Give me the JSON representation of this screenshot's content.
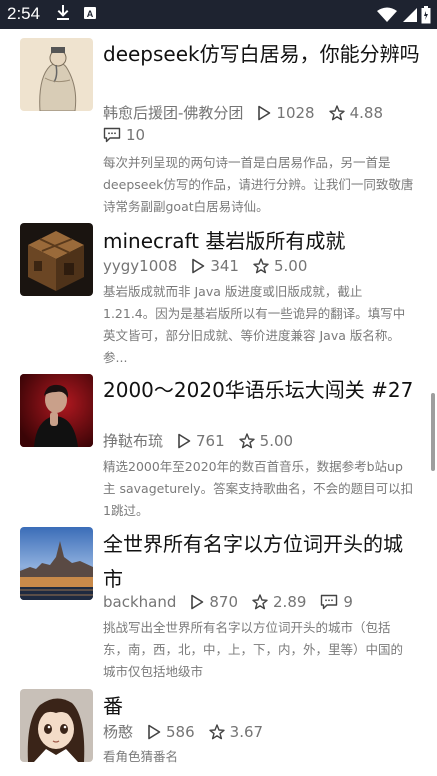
{
  "status_bar": {
    "time": "2:54",
    "icons": [
      "download-icon",
      "font-icon",
      "wifi-icon",
      "signal-icon",
      "battery-icon"
    ]
  },
  "items": [
    {
      "title": "deepseek仿写白居易，你能分辨吗",
      "author": "韩愈后援团-佛教分团",
      "plays": "1028",
      "rating": "4.88",
      "comments": "10",
      "description": "每次并列呈现的两句诗一首是白居易作品，另一首是deepseek仿写的作品，请进行分辨。让我们一同致敬唐诗常务副副goat白居易诗仙。"
    },
    {
      "title": "minecraft 基岩版所有成就",
      "author": "yygy1008",
      "plays": "341",
      "rating": "5.00",
      "description": "基岩版成就而非 Java 版进度或旧版成就，截止 1.21.4。因为是基岩版所以有一些诡异的翻译。填写中英文皆可，部分旧成就、等价进度兼容 Java 版名称。参..."
    },
    {
      "title": "2000～2020华语乐坛大闯关 #27",
      "author": "挣鞑布琉",
      "plays": "761",
      "rating": "5.00",
      "description": "精选2000年至2020年的数百首音乐，数据参考b站up主 savageturely。答案支持歌曲名，不会的题目可以扣1跳过。"
    },
    {
      "title": "全世界所有名字以方位词开头的城市",
      "author": "backhand",
      "plays": "870",
      "rating": "2.89",
      "comments": "9",
      "description": "挑战写出全世界所有名字以方位词开头的城市（包括东，南，西，北，中，上，下，内，外，里等）中国的城市仅包括地级市"
    },
    {
      "title": "番",
      "author": "杨憨",
      "plays": "586",
      "rating": "3.67",
      "description": "看角色猜番名"
    }
  ],
  "colors": {
    "status_bar_bg": "#1e2330",
    "meta_text": "#757575",
    "title_text": "#111111"
  }
}
